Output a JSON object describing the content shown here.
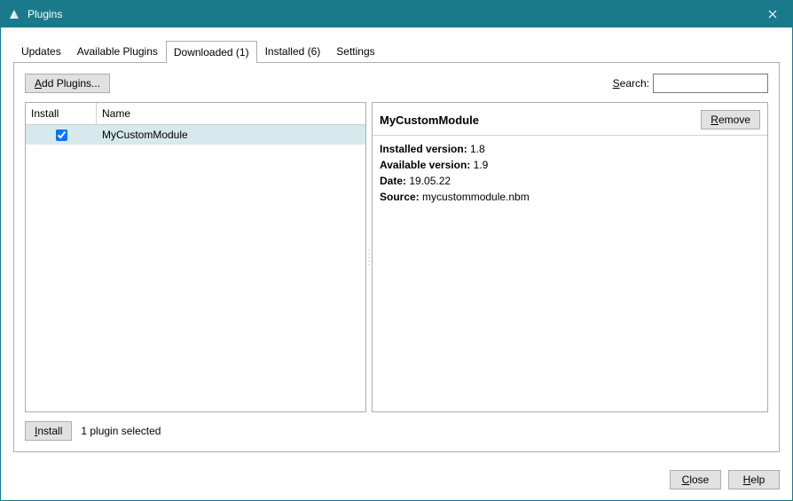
{
  "window": {
    "title": "Plugins"
  },
  "tabs": {
    "updates": "Updates",
    "available": "Available Plugins",
    "downloaded": "Downloaded (1)",
    "installed": "Installed (6)",
    "settings": "Settings"
  },
  "toolbar": {
    "add_prefix": "A",
    "add_rest": "dd Plugins...",
    "search_prefix": "S",
    "search_rest": "earch:"
  },
  "table": {
    "head_install": "Install",
    "head_name": "Name",
    "row0": {
      "name": "MyCustomModule",
      "checked": true
    }
  },
  "detail": {
    "title": "MyCustomModule",
    "remove_prefix": "R",
    "remove_rest": "emove",
    "installed_label": "Installed version:",
    "installed_value": " 1.8",
    "available_label": "Available version:",
    "available_value": " 1.9",
    "date_label": "Date:",
    "date_value": " 19.05.22",
    "source_label": "Source:",
    "source_value": " mycustommodule.nbm"
  },
  "footer": {
    "install_prefix": "I",
    "install_rest": "nstall",
    "status": "1 plugin selected"
  },
  "buttons": {
    "close_prefix": "C",
    "close_rest": "lose",
    "help_prefix": "H",
    "help_rest": "elp"
  }
}
